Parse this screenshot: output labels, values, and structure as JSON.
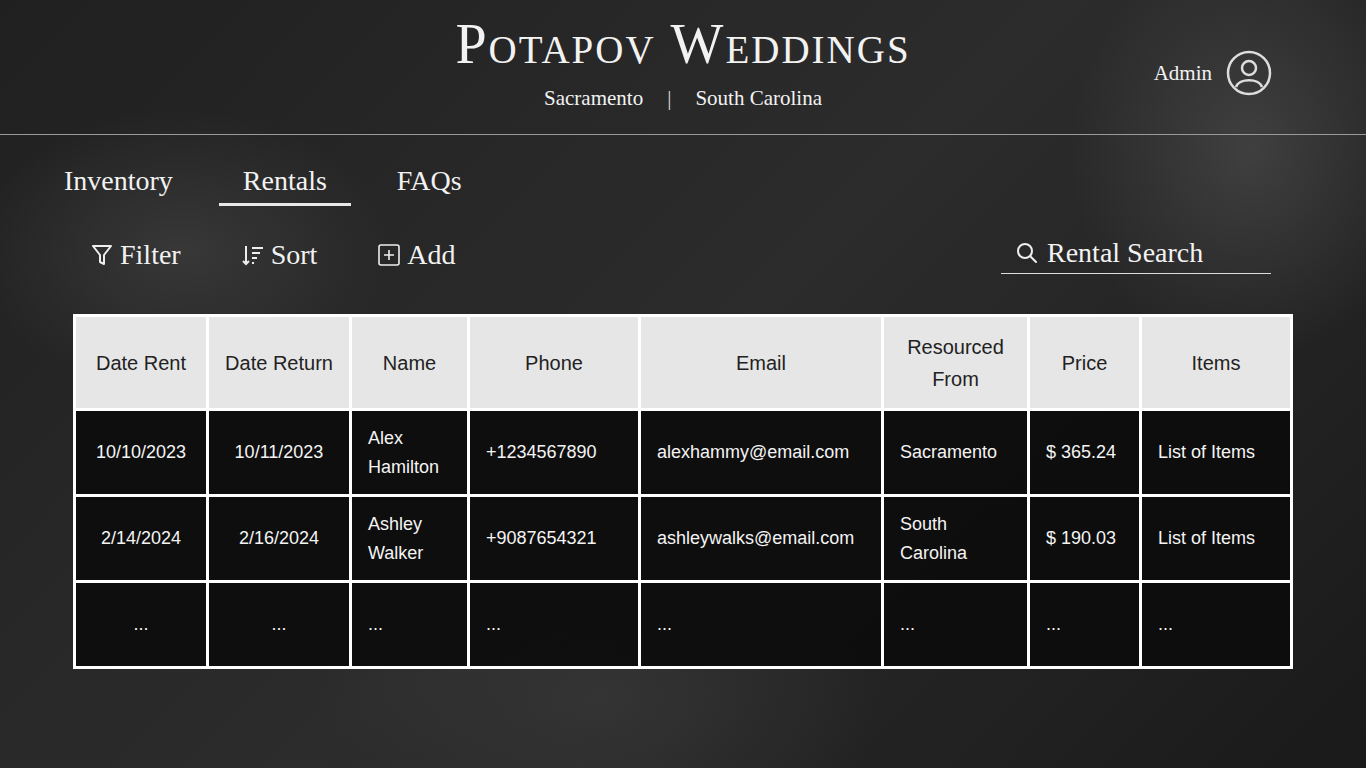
{
  "brand": {
    "title": "Potapov Weddings",
    "locations": [
      "Sacramento",
      "South Carolina"
    ],
    "separator": "|"
  },
  "user": {
    "label": "Admin"
  },
  "tabs": [
    {
      "label": "Inventory",
      "selected": false
    },
    {
      "label": "Rentals",
      "selected": true
    },
    {
      "label": "FAQs",
      "selected": false
    }
  ],
  "toolbar": {
    "filter": "Filter",
    "sort": "Sort",
    "add": "Add"
  },
  "search": {
    "placeholder": "Rental Search"
  },
  "table": {
    "columns": [
      "Date Rent",
      "Date Return",
      "Name",
      "Phone",
      "Email",
      "Resourced From",
      "Price",
      "Items"
    ],
    "rows": [
      [
        "10/10/2023",
        "10/11/2023",
        "Alex Hamilton",
        "+1234567890",
        "alexhammy@email.com",
        "Sacramento",
        "$ 365.24",
        "List of Items"
      ],
      [
        "2/14/2024",
        "2/16/2024",
        "Ashley Walker",
        "+9087654321",
        "ashleywalks@email.com",
        "South Carolina",
        "$ 190.03",
        "List of Items"
      ],
      [
        "...",
        "...",
        "...",
        "...",
        "...",
        "...",
        "...",
        "..."
      ]
    ]
  }
}
